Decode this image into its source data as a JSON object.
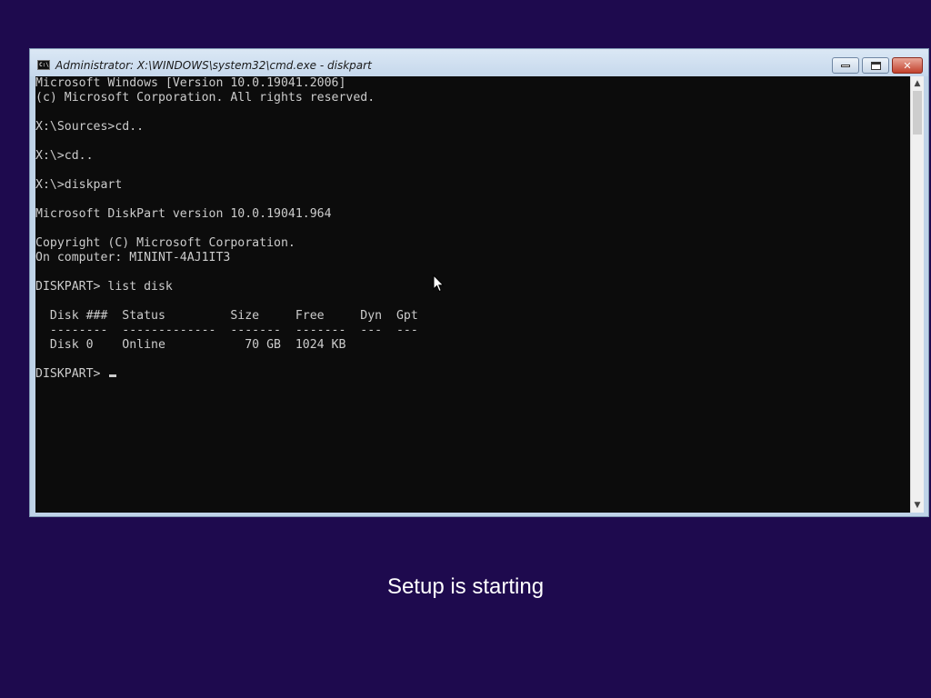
{
  "window": {
    "title": "Administrator: X:\\WINDOWS\\system32\\cmd.exe - diskpart",
    "icon": "cmd-icon",
    "icon_label": "C:\\",
    "controls": {
      "minimize": "minimize-icon",
      "maximize": "maximize-icon",
      "close": "close-icon"
    }
  },
  "console": {
    "lines": [
      "Microsoft Windows [Version 10.0.19041.2006]",
      "(c) Microsoft Corporation. All rights reserved.",
      "",
      "X:\\Sources>cd..",
      "",
      "X:\\>cd..",
      "",
      "X:\\>diskpart",
      "",
      "Microsoft DiskPart version 10.0.19041.964",
      "",
      "Copyright (C) Microsoft Corporation.",
      "On computer: MININT-4AJ1IT3",
      "",
      "DISKPART> list disk",
      "",
      "  Disk ###  Status         Size     Free     Dyn  Gpt",
      "  --------  -------------  -------  -------  ---  ---",
      "  Disk 0    Online           70 GB  1024 KB",
      "",
      "DISKPART> "
    ],
    "text_color": "#cccccc",
    "background": "#0c0c0c"
  },
  "scrollbar": {
    "up": "▲",
    "down": "▼"
  },
  "status": {
    "text": "Setup is starting"
  },
  "colors": {
    "desktop": "#1e0a4e",
    "title_bar": "#c6d8ec",
    "close_button": "#c2412d"
  }
}
